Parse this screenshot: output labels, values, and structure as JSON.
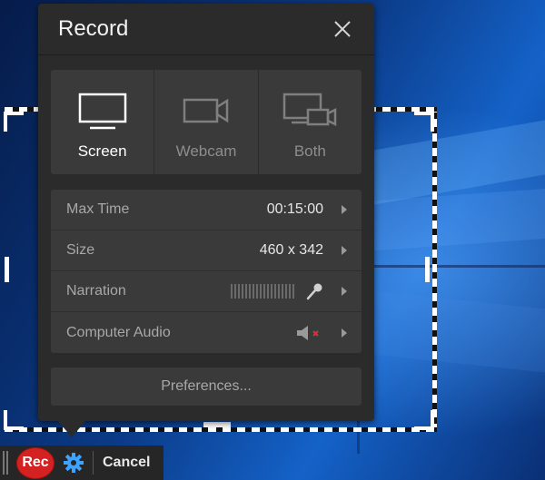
{
  "panel": {
    "title": "Record",
    "modes": [
      {
        "label": "Screen",
        "icon": "monitor-icon",
        "active": true
      },
      {
        "label": "Webcam",
        "icon": "webcam-icon",
        "active": false
      },
      {
        "label": "Both",
        "icon": "monitor-webcam-icon",
        "active": false
      }
    ],
    "settings": {
      "max_time": {
        "label": "Max Time",
        "value": "00:15:00"
      },
      "size": {
        "label": "Size",
        "value": "460 x 342"
      },
      "narration": {
        "label": "Narration",
        "icon": "microphone-icon"
      },
      "computer_audio": {
        "label": "Computer Audio",
        "icon": "speaker-muted-icon"
      }
    },
    "preferences_label": "Preferences..."
  },
  "toolbar": {
    "rec_label": "Rec",
    "cancel_label": "Cancel",
    "settings_icon": "gear-icon"
  },
  "colors": {
    "panel_bg": "#2b2b2b",
    "row_bg": "#3a3a3a",
    "rec_red": "#d42222",
    "gear_blue": "#3ea3ff",
    "mute_red": "#e03030"
  }
}
